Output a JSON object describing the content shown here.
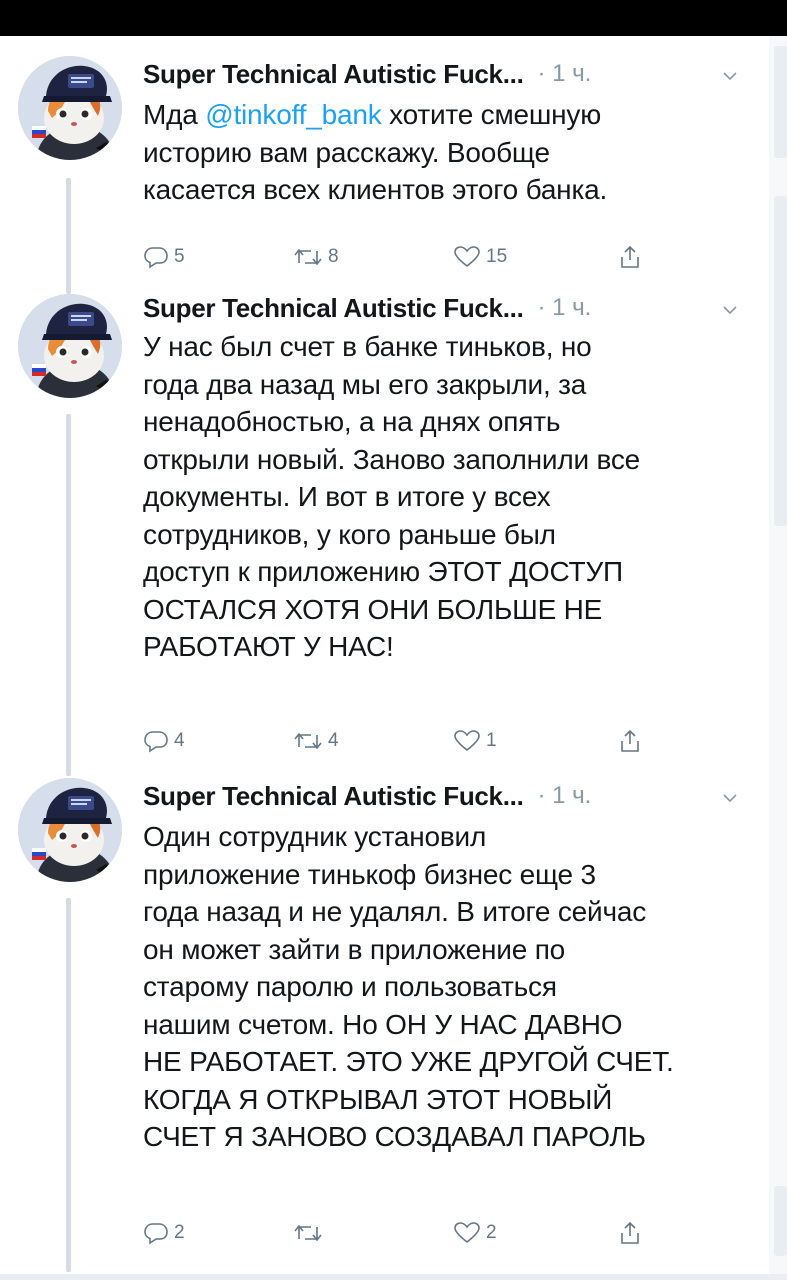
{
  "tweets": [
    {
      "author": "Super Technical Autistic Fuck...",
      "time": "· 1 ч.",
      "lines": [
        {
          "pre": "Мда ",
          "mention": "@tinkoff_bank",
          "post": " хотите смешную"
        },
        {
          "pre": "историю вам расскажу. Вообще",
          "mention": "",
          "post": ""
        },
        {
          "pre": "касается всех клиентов этого банка.",
          "mention": "",
          "post": ""
        }
      ],
      "replies": "5",
      "retweets": "8",
      "likes": "15"
    },
    {
      "author": "Super Technical Autistic Fuck...",
      "time": "· 1 ч.",
      "lines": [
        "У нас был счет в банке тиньков, но",
        "года два назад мы его закрыли, за",
        "ненадобностью, а на днях опять",
        "открыли новый. Заново заполнили все",
        "документы. И вот в итоге у всех",
        "сотрудников, у кого раньше был",
        "доступ к приложению ЭТОТ ДОСТУП",
        "ОСТАЛСЯ ХОТЯ ОНИ БОЛЬШЕ НЕ",
        "РАБОТАЮТ У НАС!"
      ],
      "replies": "4",
      "retweets": "4",
      "likes": "1"
    },
    {
      "author": "Super Technical Autistic Fuck...",
      "time": "· 1 ч.",
      "lines": [
        "Один сотрудник установил",
        "приложение тинькоф бизнес еще 3",
        "года назад и не удалял. В итоге сейчас",
        "он может зайти в приложение по",
        "старому паролю и пользоваться",
        "нашим счетом. Но ОН У НАС ДАВНО",
        "НЕ РАБОТАЕТ. ЭТО УЖЕ ДРУГОЙ СЧЕТ.",
        "КОГДА Я ОТКРЫВАЛ ЭТОТ НОВЫЙ",
        "СЧЕТ Я ЗАНОВО СОЗДАВАЛ ПАРОЛЬ"
      ],
      "replies": "2",
      "retweets": "",
      "likes": "2"
    }
  ],
  "icons": {
    "reply": "reply-icon",
    "retweet": "retweet-icon",
    "like": "heart-icon",
    "share": "share-icon",
    "more": "chevron-down-icon"
  },
  "colors": {
    "mention": "#1da1f2",
    "secondary_text": "#8899a6",
    "icon": "#657786",
    "thread_line": "#d4dbe3"
  }
}
